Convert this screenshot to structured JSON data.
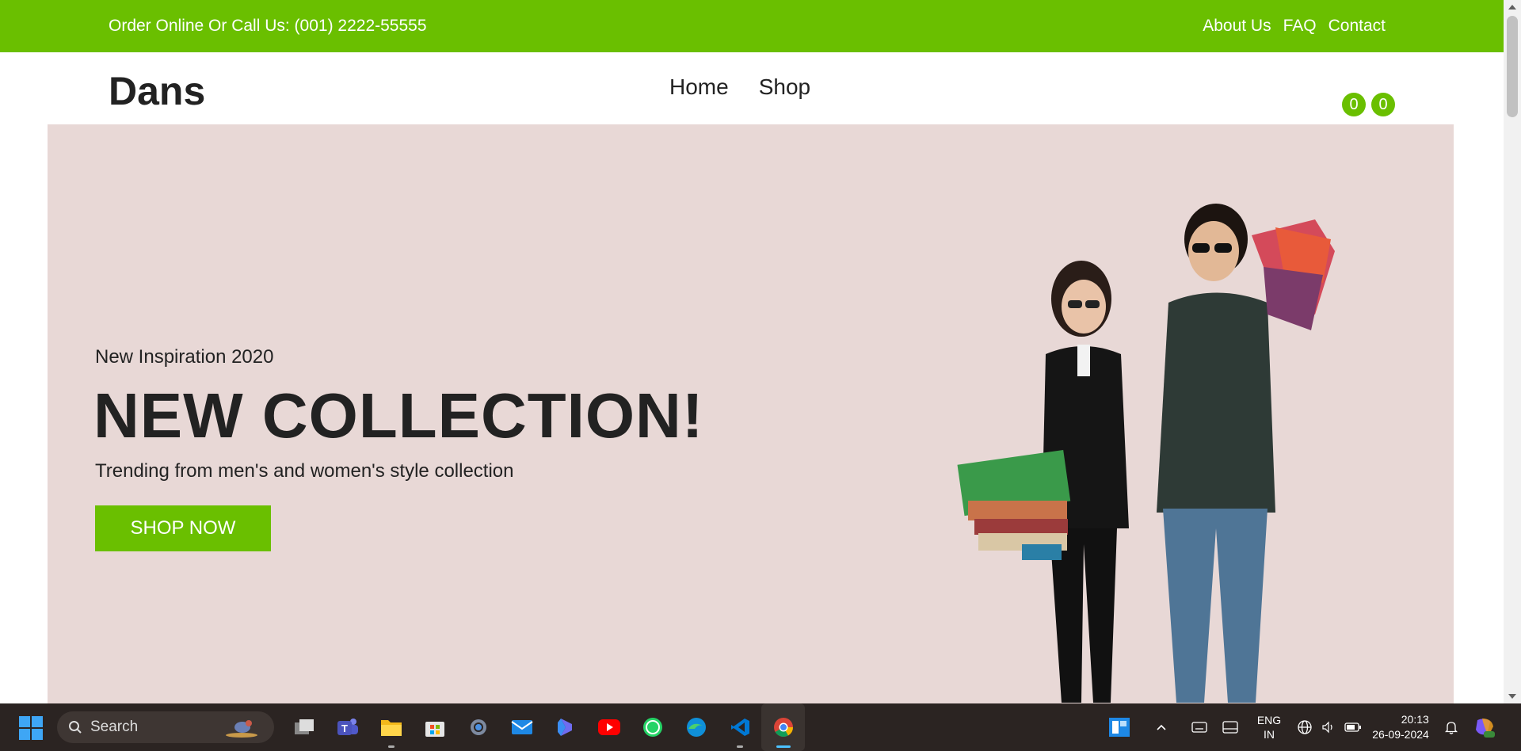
{
  "topbar": {
    "phone": "Order Online Or Call Us: (001) 2222-55555",
    "links": [
      "About Us",
      "FAQ",
      "Contact"
    ]
  },
  "header": {
    "logo": "Dans",
    "nav": [
      "Home",
      "Shop"
    ],
    "wishlist_count": "0",
    "cart_count": "0"
  },
  "hero": {
    "subtitle": "New Inspiration 2020",
    "title": "NEW COLLECTION!",
    "tagline": "Trending from men's and women's style collection",
    "button": "SHOP NOW"
  },
  "colors": {
    "accent": "#6abf00",
    "hero_bg": "#e8d8d6",
    "taskbar": "#2b2422"
  },
  "taskbar": {
    "search_label": "Search",
    "apps": [
      "task-view-icon",
      "teams-icon",
      "file-explorer-icon",
      "microsoft-store-icon",
      "settings-icon",
      "mail-icon",
      "copilot-icon",
      "youtube-icon",
      "whatsapp-icon",
      "edge-icon",
      "vscode-icon",
      "chrome-icon"
    ],
    "lang_line1": "ENG",
    "lang_line2": "IN",
    "time": "20:13",
    "date": "26-09-2024"
  }
}
